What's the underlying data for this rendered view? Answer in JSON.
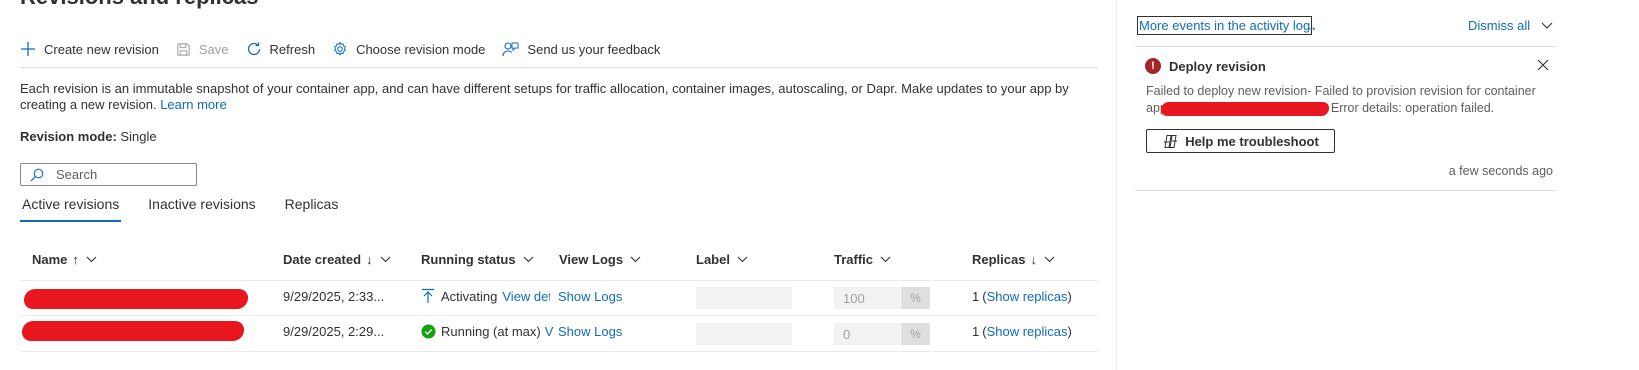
{
  "page": {
    "title": "Revisions and replicas"
  },
  "toolbar": {
    "create_label": "Create new revision",
    "save_label": "Save",
    "refresh_label": "Refresh",
    "choose_mode_label": "Choose revision mode",
    "feedback_label": "Send us your feedback"
  },
  "description": {
    "text": "Each revision is an immutable snapshot of your container app, and can have different setups for traffic allocation, container images, autoscaling, or Dapr. Make updates to your app by creating a new revision.",
    "learn_more": "Learn more"
  },
  "revision_mode": {
    "label": "Revision mode:",
    "value": "Single"
  },
  "search": {
    "placeholder": "Search"
  },
  "tabs": [
    {
      "label": "Active revisions",
      "active": true
    },
    {
      "label": "Inactive revisions",
      "active": false
    },
    {
      "label": "Replicas",
      "active": false
    }
  ],
  "table": {
    "columns": [
      {
        "label": "Name",
        "sort": "↑"
      },
      {
        "label": "Date created",
        "sort": "↓"
      },
      {
        "label": "Running status",
        "sort": ""
      },
      {
        "label": "View Logs",
        "sort": ""
      },
      {
        "label": "Label",
        "sort": ""
      },
      {
        "label": "Traffic",
        "sort": ""
      },
      {
        "label": "Replicas",
        "sort": "↓"
      }
    ],
    "rows": [
      {
        "date": "9/29/2025, 2:33...",
        "status": "Activating",
        "status_link": "View det",
        "status_icon": "arrow-up-icon",
        "logs": "Show Logs",
        "traffic": "100",
        "traffic_unit": "%",
        "replicas_count": "1",
        "replicas_link": "Show replicas"
      },
      {
        "date": "9/29/2025, 2:29...",
        "status": "Running (at max)",
        "status_link": "V",
        "status_icon": "check-circle-icon",
        "logs": "Show Logs",
        "traffic": "0",
        "traffic_unit": "%",
        "replicas_count": "1",
        "replicas_link": "Show replicas"
      }
    ]
  },
  "notifications": {
    "activity_link": "More events in the activity log",
    "activity_arrow": "→",
    "dismiss_all": "Dismiss all",
    "item": {
      "title": "Deploy revision",
      "message_before": "Failed to deploy new revision- Failed to provision revision for container",
      "message_app": "app",
      "message_after": "Error details: operation failed.",
      "help_button": "Help me troubleshoot",
      "time": "a few seconds ago"
    }
  },
  "colors": {
    "accent": "#0f6cbd",
    "error": "#a4262c",
    "success": "#13a10e",
    "redaction": "#e8171f"
  }
}
